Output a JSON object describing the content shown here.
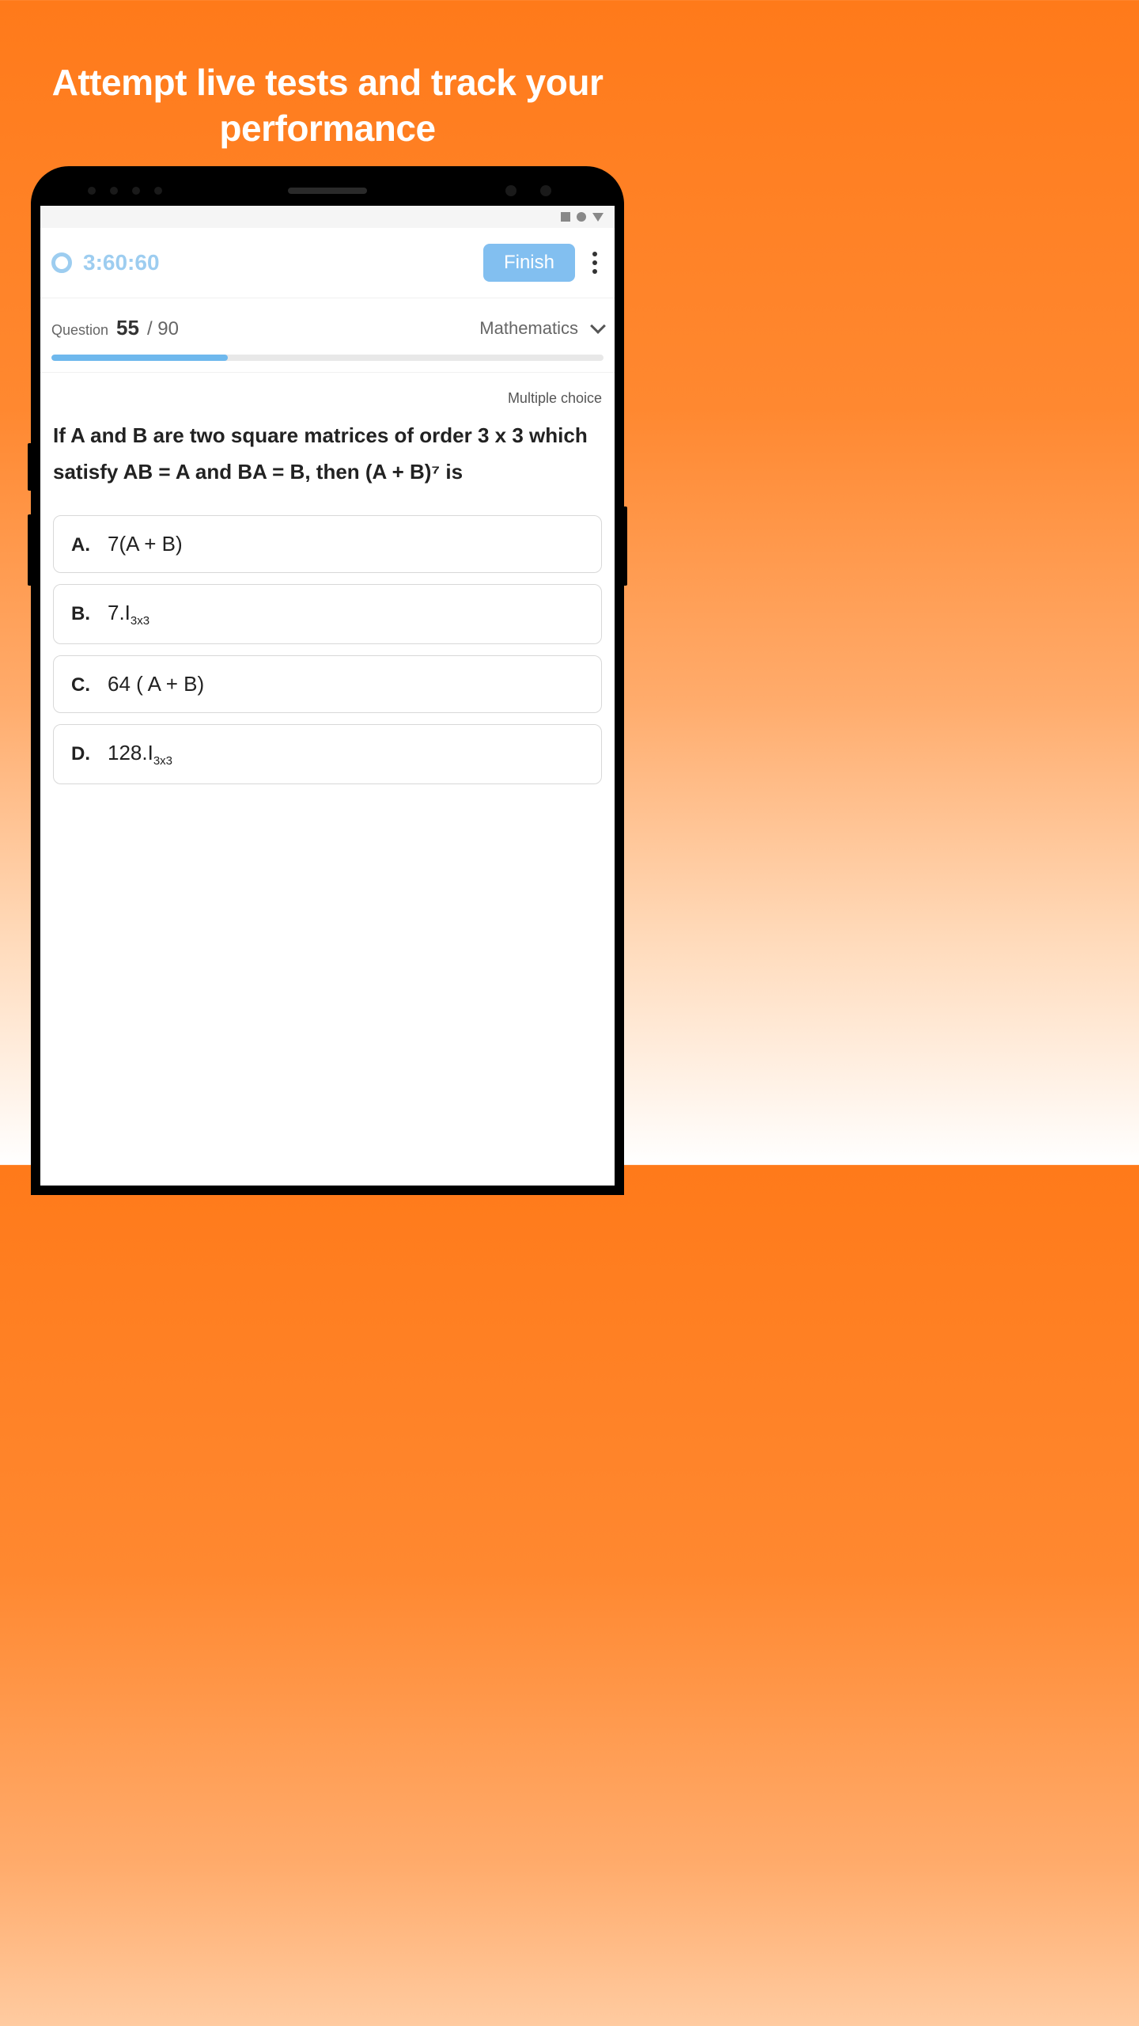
{
  "headline": "Attempt live tests and track your performance",
  "timer": "3:60:60",
  "finish_label": "Finish",
  "question": {
    "label": "Question",
    "current": "55",
    "total": "/ 90",
    "subject": "Mathematics",
    "progress_percent": 32,
    "type": "Multiple choice",
    "text": "If A and B are two square matrices of order 3 x 3 which satisfy AB = A and BA = B, then (A + B)⁷ is",
    "options": [
      {
        "letter": "A.",
        "text": "7(A + B)",
        "has_sub": false
      },
      {
        "letter": "B.",
        "text": "7.I",
        "sub": "3x3",
        "has_sub": true
      },
      {
        "letter": "C.",
        "text": "64 ( A + B)",
        "has_sub": false
      },
      {
        "letter": "D.",
        "text": "128.I",
        "sub": "3x3",
        "has_sub": true
      }
    ]
  }
}
